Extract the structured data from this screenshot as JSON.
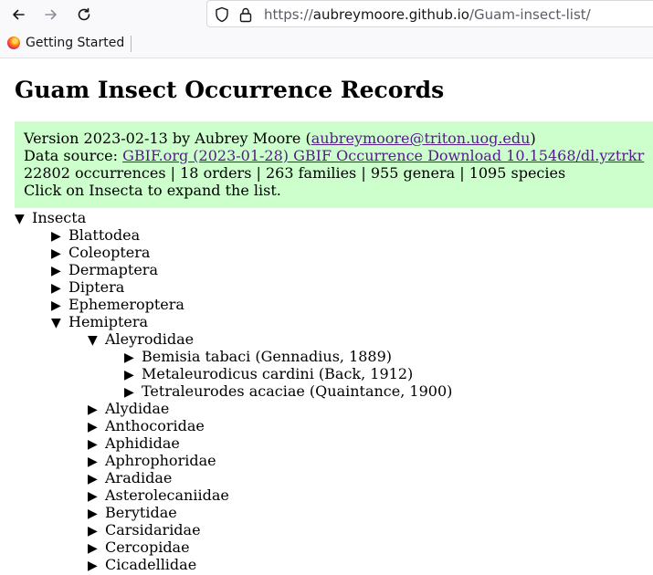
{
  "browser": {
    "url_scheme": "https://",
    "url_host": "aubreymoore.github.io",
    "url_path": "/Guam-insect-list/",
    "bookmark_label": "Getting Started"
  },
  "page": {
    "title": "Guam Insect Occurrence Records",
    "info": {
      "version_prefix": "Version 2023-02-13 by Aubrey Moore (",
      "email": "aubreymoore@triton.uog.edu",
      "version_suffix": ")",
      "source_prefix": "Data source: ",
      "source_link": "GBIF.org (2023-01-28) GBIF Occurrence Download 10.15468/dl.yztrkr",
      "stats": "22802 occurrences | 18 orders | 263 families | 955 genera | 1095 species",
      "instruction": "Click on Insecta to expand the list."
    },
    "tree": [
      {
        "level": 0,
        "expanded": true,
        "label": "Insecta",
        "marker": "▼"
      },
      {
        "level": 1,
        "expanded": false,
        "label": "Blattodea",
        "marker": "▶"
      },
      {
        "level": 1,
        "expanded": false,
        "label": "Coleoptera",
        "marker": "▶"
      },
      {
        "level": 1,
        "expanded": false,
        "label": "Dermaptera",
        "marker": "▶"
      },
      {
        "level": 1,
        "expanded": false,
        "label": "Diptera",
        "marker": "▶"
      },
      {
        "level": 1,
        "expanded": false,
        "label": "Ephemeroptera",
        "marker": "▶"
      },
      {
        "level": 1,
        "expanded": true,
        "label": "Hemiptera",
        "marker": "▼"
      },
      {
        "level": 2,
        "expanded": true,
        "label": "Aleyrodidae",
        "marker": "▼"
      },
      {
        "level": 3,
        "expanded": false,
        "label": "Bemisia tabaci (Gennadius, 1889)",
        "marker": "▶"
      },
      {
        "level": 3,
        "expanded": false,
        "label": "Metaleurodicus cardini (Back, 1912)",
        "marker": "▶"
      },
      {
        "level": 3,
        "expanded": false,
        "label": "Tetraleurodes acaciae (Quaintance, 1900)",
        "marker": "▶"
      },
      {
        "level": 2,
        "expanded": false,
        "label": "Alydidae",
        "marker": "▶"
      },
      {
        "level": 2,
        "expanded": false,
        "label": "Anthocoridae",
        "marker": "▶"
      },
      {
        "level": 2,
        "expanded": false,
        "label": "Aphididae",
        "marker": "▶"
      },
      {
        "level": 2,
        "expanded": false,
        "label": "Aphrophoridae",
        "marker": "▶"
      },
      {
        "level": 2,
        "expanded": false,
        "label": "Aradidae",
        "marker": "▶"
      },
      {
        "level": 2,
        "expanded": false,
        "label": "Asterolecaniidae",
        "marker": "▶"
      },
      {
        "level": 2,
        "expanded": false,
        "label": "Berytidae",
        "marker": "▶"
      },
      {
        "level": 2,
        "expanded": false,
        "label": "Carsidaridae",
        "marker": "▶"
      },
      {
        "level": 2,
        "expanded": false,
        "label": "Cercopidae",
        "marker": "▶"
      },
      {
        "level": 2,
        "expanded": false,
        "label": "Cicadellidae",
        "marker": "▶"
      }
    ]
  }
}
